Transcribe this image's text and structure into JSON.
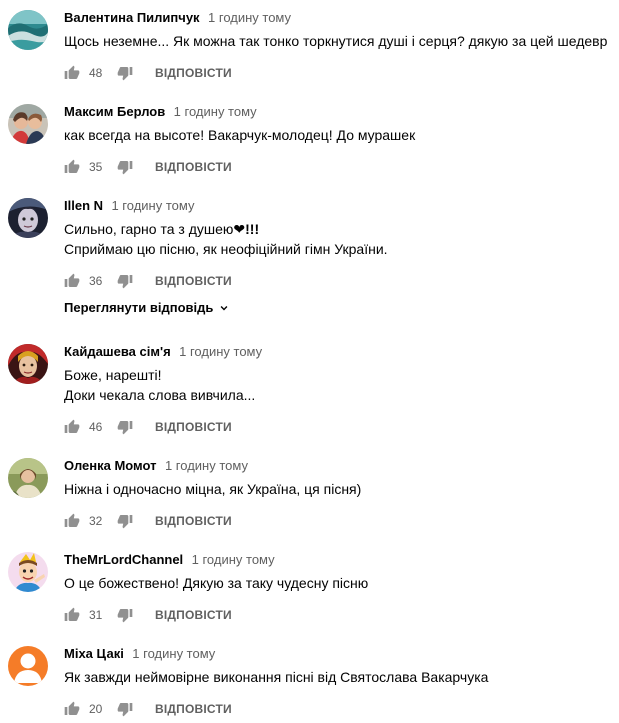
{
  "comments": [
    {
      "author": "Валентина Пилипчук",
      "time": "1 годину тому",
      "lines": [
        "Щось неземне... Як можна так тонко торкнутися душі і серця? дякую за цей шедевр"
      ],
      "likes": "48",
      "reply_label": "ВІДПОВІСТИ",
      "avatar": "sea-wave"
    },
    {
      "author": "Максим Берлов",
      "time": "1 годину тому",
      "lines": [
        "как всегда на высоте! Вакарчук-молодец! До мурашек"
      ],
      "likes": "35",
      "reply_label": "ВІДПОВІСТИ",
      "avatar": "couple-photo"
    },
    {
      "author": "Illen N",
      "time": "1 годину тому",
      "lines": [
        "Сильно, гарно та з душею",
        "Сприймаю цю пісню, як неофіційний гімн України."
      ],
      "line1_suffix": "❤!!!",
      "likes": "36",
      "reply_label": "ВІДПОВІСТИ",
      "view_replies": "Переглянути відповідь",
      "avatar": "dark-face"
    },
    {
      "author": "Кайдашева сім'я",
      "time": "1 годину тому",
      "lines": [
        "Боже, нарешті!",
        "Доки чекала слова вивчила..."
      ],
      "likes": "46",
      "reply_label": "ВІДПОВІСТИ",
      "avatar": "red-portrait"
    },
    {
      "author": "Оленка Момот",
      "time": "1 годину тому",
      "lines": [
        "Ніжна і одночасно міцна, як Україна, ця пісня)"
      ],
      "likes": "32",
      "reply_label": "ВІДПОВІСТИ",
      "avatar": "nature-photo"
    },
    {
      "author": "TheMrLordChannel",
      "time": "1 годину тому",
      "lines": [
        "О це божествено! Дякую за таку чудесну пісню"
      ],
      "likes": "31",
      "reply_label": "ВІДПОВІСТИ",
      "avatar": "cartoon-character"
    },
    {
      "author": "Міха Цакі",
      "time": "1 годину тому",
      "lines": [
        "Як завжди неймовірне виконання пісні від Святослава Вакарчука"
      ],
      "likes": "20",
      "reply_label": "ВІДПОВІСТИ",
      "avatar": "default-user"
    }
  ],
  "colors": {
    "author": "#030303",
    "meta": "#606060",
    "icon": "#909090",
    "default_avatar": "#f57c28"
  }
}
